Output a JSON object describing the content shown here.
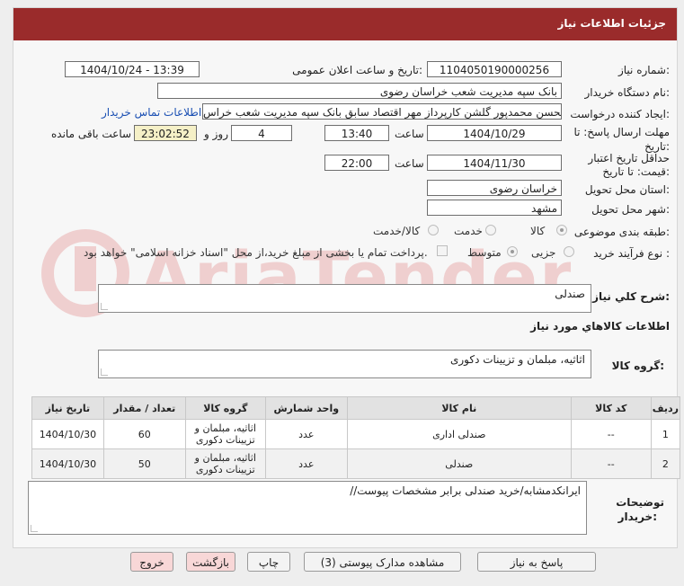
{
  "header": {
    "title": "جزئیات اطلاعات نیاز"
  },
  "form": {
    "need_number_label": "شماره نیاز:",
    "need_number": "1104050190000256",
    "announce_label": "تاریخ و ساعت اعلان عمومی:",
    "announce_value": "1404/10/24 - 13:39",
    "buyer_label": "نام دستگاه خریدار:",
    "buyer_value": "بانک سپه مدیریت شعب خراسان رضوی",
    "creator_label": "ایجاد کننده درخواست:",
    "creator_value": "محسن محمدپور گلشن کارپرداز مهر اقتصاد سابق بانک سپه مدیریت شعب خراس",
    "contact_link": "اطلاعات تماس خریدار",
    "deadline_label": "مهلت ارسال پاسخ: تا",
    "deadline_label2": "تاریخ:",
    "deadline_date": "1404/10/29",
    "time_label": "ساعت",
    "deadline_time": "13:40",
    "days_value": "4",
    "days_label": "روز و",
    "remaining_value": "23:02:52",
    "remaining_label": "ساعت باقی مانده",
    "validity_label": "حداقل تاریخ اعتبار",
    "validity_label2": "قیمت: تا تاریخ:",
    "validity_date": "1404/11/30",
    "validity_time": "22:00",
    "province_label": "استان محل تحویل:",
    "province_value": "خراسان رضوی",
    "city_label": "شهر محل تحویل:",
    "city_value": "مشهد",
    "category_label": "طبقه بندی موضوعی:",
    "category_options": [
      "کالا",
      "خدمت",
      "کالا/خدمت"
    ],
    "process_label": "نوع فرآیند خرید :",
    "process_options": [
      "جزیی",
      "متوسط"
    ],
    "payment_note": "پرداخت تمام یا بخشی از مبلغ خرید،از محل \"اسناد خزانه اسلامی\" خواهد بود."
  },
  "summary": {
    "label": "شرح کلي نياز:",
    "value": "صندلی"
  },
  "goods_info_title": "اطلاعات کالاهاي مورد نياز",
  "group": {
    "label": "گروه کالا:",
    "value": "اثاثیه، مبلمان و تزیینات دکوری"
  },
  "table": {
    "headers": [
      "ردیف",
      "کد کالا",
      "نام کالا",
      "واحد شمارش",
      "گروه کالا",
      "تعداد / مقدار",
      "تاریخ نیاز"
    ],
    "rows": [
      [
        "1",
        "--",
        "صندلی اداری",
        "عدد",
        "اثاثیه، مبلمان و تزیینات دکوری",
        "60",
        "1404/10/30"
      ],
      [
        "2",
        "--",
        "صندلی",
        "عدد",
        "اثاثیه، مبلمان و تزیینات دکوری",
        "50",
        "1404/10/30"
      ]
    ]
  },
  "notes": {
    "label1": "توضیحات",
    "label2": "خریدار:",
    "value": "ایرانکدمشابه/خرید صندلی برابر مشخصات پیوست//"
  },
  "buttons": {
    "reply": "پاسخ به نیاز",
    "docs": "مشاهده مدارک پیوستی (3)",
    "print": "چاپ",
    "back": "بازگشت",
    "exit": "خروج"
  },
  "colors": {
    "header": "#9a2b2b",
    "link": "#1a4fb3",
    "remaining_bg": "#f5f0c7"
  }
}
